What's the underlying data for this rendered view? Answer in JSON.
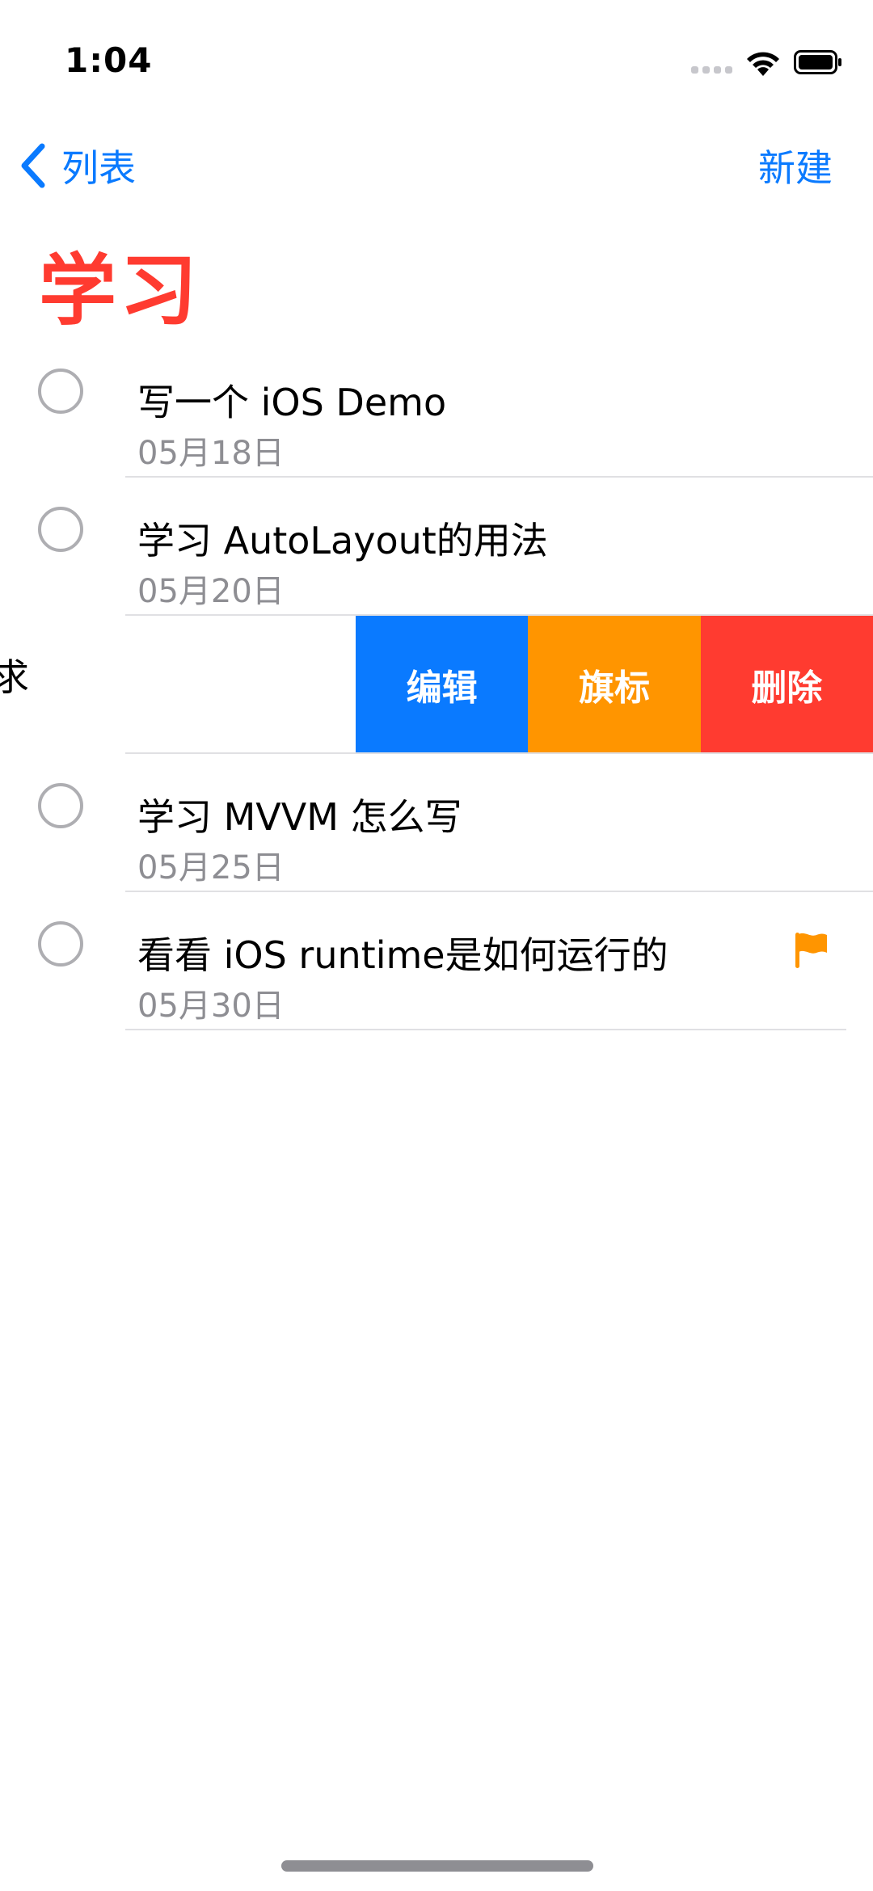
{
  "status_bar": {
    "time": "1:04"
  },
  "nav": {
    "back_label": "列表",
    "new_label": "新建"
  },
  "page_title": "学习",
  "colors": {
    "accent": "#0a7aff",
    "title": "#ff3b30",
    "flag": "#ff9500",
    "delete": "#ff3b30"
  },
  "todos": [
    {
      "title": "写一个 iOS Demo",
      "date": "05月18日",
      "flagged": false
    },
    {
      "title": "学习 AutoLayout的用法",
      "date": "05月20日",
      "flagged": false
    },
    {
      "title": "求",
      "date": "",
      "flagged": false,
      "swiped": true
    },
    {
      "title": "学习 MVVM 怎么写",
      "date": "05月25日",
      "flagged": false
    },
    {
      "title": "看看 iOS runtime是如何运行的",
      "date": "05月30日",
      "flagged": true
    }
  ],
  "swipe_actions": {
    "edit": "编辑",
    "flag": "旗标",
    "delete": "删除"
  },
  "icons": {
    "back": "chevron-left-icon",
    "flag": "flag-icon",
    "wifi": "wifi-icon",
    "battery": "battery-icon"
  }
}
